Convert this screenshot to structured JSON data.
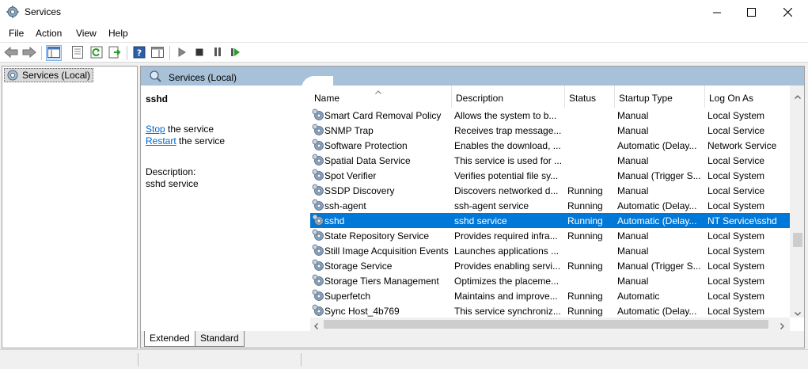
{
  "window": {
    "title": "Services",
    "icon": "gear-icon",
    "controls": [
      "minimize-icon",
      "maximize-icon",
      "close-icon"
    ]
  },
  "menu": [
    "File",
    "Action",
    "View",
    "Help"
  ],
  "toolbar": {
    "icons": [
      "back-arrow-icon",
      "forward-arrow-icon",
      "show-hide-tree-icon",
      "properties-icon",
      "refresh-icon",
      "export-list-icon",
      "help-icon",
      "show-action-pane-icon",
      "start-service-icon",
      "stop-service-icon",
      "pause-service-icon",
      "resume-service-icon"
    ]
  },
  "tree": {
    "root_label": "Services (Local)"
  },
  "header": {
    "label": "Services (Local)"
  },
  "detail": {
    "service_name": "sshd",
    "stop_link": "Stop",
    "stop_suffix": " the service",
    "restart_link": "Restart",
    "restart_suffix": " the service",
    "description_label": "Description:",
    "description_value": "sshd service"
  },
  "columns": [
    "Name",
    "Description",
    "Status",
    "Startup Type",
    "Log On As"
  ],
  "rows": [
    {
      "name": "Smart Card Removal Policy",
      "description": "Allows the system to b...",
      "status": "",
      "startup": "Manual",
      "logon": "Local System",
      "selected": false
    },
    {
      "name": "SNMP Trap",
      "description": "Receives trap message...",
      "status": "",
      "startup": "Manual",
      "logon": "Local Service",
      "selected": false
    },
    {
      "name": "Software Protection",
      "description": "Enables the download, ...",
      "status": "",
      "startup": "Automatic (Delay...",
      "logon": "Network Service",
      "selected": false
    },
    {
      "name": "Spatial Data Service",
      "description": "This service is used for ...",
      "status": "",
      "startup": "Manual",
      "logon": "Local Service",
      "selected": false
    },
    {
      "name": "Spot Verifier",
      "description": "Verifies potential file sy...",
      "status": "",
      "startup": "Manual (Trigger S...",
      "logon": "Local System",
      "selected": false
    },
    {
      "name": "SSDP Discovery",
      "description": "Discovers networked d...",
      "status": "Running",
      "startup": "Manual",
      "logon": "Local Service",
      "selected": false
    },
    {
      "name": "ssh-agent",
      "description": "ssh-agent service",
      "status": "Running",
      "startup": "Automatic (Delay...",
      "logon": "Local System",
      "selected": false
    },
    {
      "name": "sshd",
      "description": "sshd service",
      "status": "Running",
      "startup": "Automatic (Delay...",
      "logon": "NT Service\\sshd",
      "selected": true
    },
    {
      "name": "State Repository Service",
      "description": "Provides required infra...",
      "status": "Running",
      "startup": "Manual",
      "logon": "Local System",
      "selected": false
    },
    {
      "name": "Still Image Acquisition Events",
      "description": "Launches applications ...",
      "status": "",
      "startup": "Manual",
      "logon": "Local System",
      "selected": false
    },
    {
      "name": "Storage Service",
      "description": "Provides enabling servi...",
      "status": "Running",
      "startup": "Manual (Trigger S...",
      "logon": "Local System",
      "selected": false
    },
    {
      "name": "Storage Tiers Management",
      "description": "Optimizes the placeme...",
      "status": "",
      "startup": "Manual",
      "logon": "Local System",
      "selected": false
    },
    {
      "name": "Superfetch",
      "description": "Maintains and improve...",
      "status": "Running",
      "startup": "Automatic",
      "logon": "Local System",
      "selected": false
    },
    {
      "name": "Sync Host_4b769",
      "description": "This service synchroniz...",
      "status": "Running",
      "startup": "Automatic (Delay...",
      "logon": "Local System",
      "selected": false
    }
  ],
  "tabs": [
    "Extended",
    "Standard"
  ],
  "colors": {
    "selection": "#0078d7",
    "header_band": "#a7c1d9",
    "link": "#0066cc"
  }
}
